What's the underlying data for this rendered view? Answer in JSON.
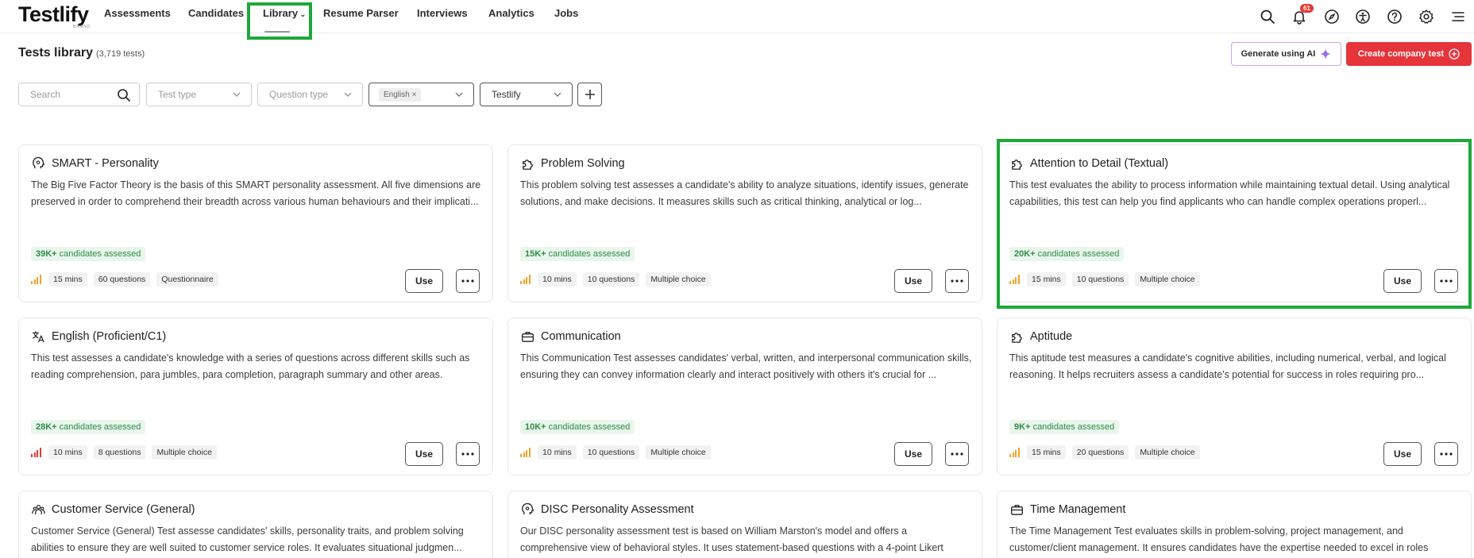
{
  "nav": {
    "logo": "Testlify",
    "logo_sub": "BRAND",
    "items": [
      {
        "label": "Assessments"
      },
      {
        "label": "Candidates"
      },
      {
        "label": "Library"
      },
      {
        "label": "Resume Parser"
      },
      {
        "label": "Interviews"
      },
      {
        "label": "Analytics"
      },
      {
        "label": "Jobs"
      }
    ],
    "notification_count": "61",
    "icons": [
      "search-icon",
      "bell-icon",
      "compass-icon",
      "accessibility-icon",
      "help-icon",
      "settings-icon",
      "menu-icon"
    ]
  },
  "header": {
    "title": "Tests library",
    "count": "(3,719 tests)",
    "generate_ai_label": "Generate using AI",
    "create_label": "Create company test"
  },
  "filters": {
    "search_placeholder": "Search",
    "test_type": "Test type",
    "question_type": "Question type",
    "language_chip": "English",
    "provider": "Testlify"
  },
  "colors": {
    "accent_red": "#e5343a",
    "highlight_green": "#1ea83a",
    "assessed_green": "#2e8b46",
    "difficulty_orange": "#f2a12b"
  },
  "cards": [
    {
      "title": "SMART - Personality",
      "icon": "head-icon",
      "description": "The Big Five Factor Theory is the basis of this SMART personality assessment. All five dimensions are preserved in order to comprehend their breadth across various human behaviours and their implicati...",
      "assessed_count": "39K+",
      "assessed_label": "candidates assessed",
      "duration": "15 mins",
      "questions": "60 questions",
      "qtype": "Questionnaire",
      "use_label": "Use"
    },
    {
      "title": "Problem Solving",
      "icon": "puzzle-icon",
      "description": "This problem solving test assesses a candidate's ability to analyze situations, identify issues, generate solutions, and make decisions. It measures skills such as critical thinking, analytical or log...",
      "assessed_count": "15K+",
      "assessed_label": "candidates assessed",
      "duration": "10 mins",
      "questions": "10 questions",
      "qtype": "Multiple choice",
      "use_label": "Use"
    },
    {
      "title": "Attention to Detail (Textual)",
      "icon": "puzzle-icon",
      "description": "This test evaluates the ability to process information while maintaining textual detail. Using analytical capabilities, this test can help you find applicants who can handle complex operations properl...",
      "assessed_count": "20K+",
      "assessed_label": "candidates assessed",
      "duration": "15 mins",
      "questions": "10 questions",
      "qtype": "Multiple choice",
      "use_label": "Use"
    },
    {
      "title": "English (Proficient/C1)",
      "icon": "translate-icon",
      "description": "This test assesses a candidate's knowledge with a series of questions across different skills such as reading comprehension, para jumbles, para completion, paragraph summary and other areas.",
      "assessed_count": "28K+",
      "assessed_label": "candidates assessed",
      "duration": "10 mins",
      "questions": "8 questions",
      "qtype": "Multiple choice",
      "use_label": "Use"
    },
    {
      "title": "Communication",
      "icon": "briefcase-icon",
      "description": "This Communication Test assesses candidates' verbal, written, and interpersonal communication skills, ensuring they can convey information clearly and interact positively with others it's crucial for ...",
      "assessed_count": "10K+",
      "assessed_label": "candidates assessed",
      "duration": "10 mins",
      "questions": "10 questions",
      "qtype": "Multiple choice",
      "use_label": "Use"
    },
    {
      "title": "Aptitude",
      "icon": "puzzle-icon",
      "description": "This aptitude test measures a candidate's cognitive abilities, including numerical, verbal, and logical reasoning. It helps recruiters assess a candidate's potential for success in roles requiring pro...",
      "assessed_count": "9K+",
      "assessed_label": "candidates assessed",
      "duration": "15 mins",
      "questions": "20 questions",
      "qtype": "Multiple choice",
      "use_label": "Use"
    },
    {
      "title": "Customer Service (General)",
      "icon": "people-icon",
      "description": "Customer Service (General) Test assesse candidates' skills, personality traits, and problem solving abilities to ensure they are well suited to customer service roles. It evaluates situational judgmen..."
    },
    {
      "title": "DISC Personality Assessment",
      "icon": "head-icon",
      "description": "Our DISC personality assessment test is based on William Marston's model and offers a comprehensive view of behavioral styles. It uses statement-based questions with a 4-point Likert"
    },
    {
      "title": "Time Management",
      "icon": "briefcase-icon",
      "description": "The Time Management Test evaluates skills in problem-solving, project management, and customer/client management. It ensures candidates have the expertise needed to excel in roles"
    }
  ]
}
